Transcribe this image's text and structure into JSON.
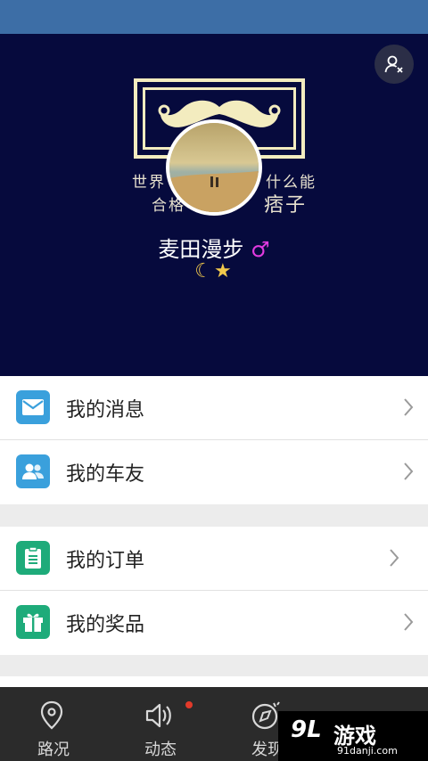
{
  "profile": {
    "username": "麦田漫步",
    "gender_symbol": "♂",
    "level_icons": "☾★",
    "banner_text_line1_left": "世界",
    "banner_text_line1_right": "什么能",
    "banner_text_line2_left": "合格",
    "banner_text_line2_right": "痞子"
  },
  "menu_group1": [
    {
      "label": "我的消息",
      "icon": "mail-icon"
    },
    {
      "label": "我的车友",
      "icon": "friends-icon"
    }
  ],
  "menu_group2": [
    {
      "label": "我的订单",
      "icon": "order-icon"
    },
    {
      "label": "我的奖品",
      "icon": "gift-icon"
    }
  ],
  "tabs": [
    {
      "label": "路况",
      "icon": "location-pin-icon"
    },
    {
      "label": "动态",
      "icon": "speaker-icon"
    },
    {
      "label": "发现",
      "icon": "compass-icon"
    }
  ],
  "watermark": {
    "logo": "9L",
    "text": "游戏",
    "url": "91danji.com"
  },
  "colors": {
    "hero_bg": "#060a3d",
    "mail_icon": "#3aa0dc",
    "friends_icon": "#3aa0dc",
    "order_icon": "#1eab7a",
    "gift_icon": "#1eab7a",
    "gender": "#e23be0",
    "badge": "#e23a2a"
  }
}
